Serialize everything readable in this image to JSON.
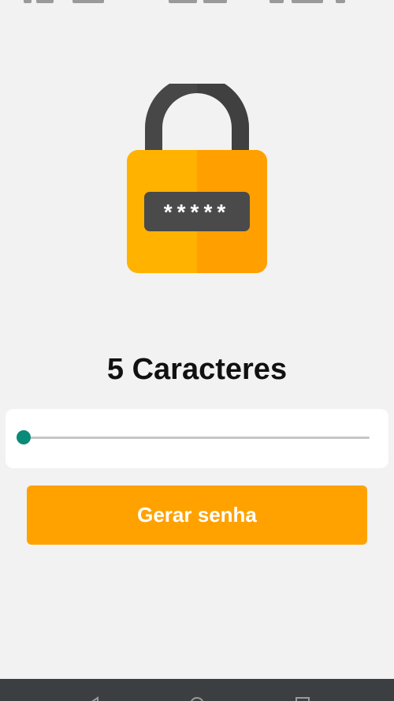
{
  "header": {
    "icon": "padlock-icon",
    "masked_password": "*****"
  },
  "length_label": "5 Caracteres",
  "slider": {
    "value": 5,
    "min": 5,
    "accent_color": "#0a8a78",
    "track_color": "#c6c6c6"
  },
  "button": {
    "label": "Gerar senha",
    "color": "#ffa200"
  },
  "navigation": {
    "items": [
      "back-icon",
      "home-icon",
      "recents-icon"
    ],
    "color": "#3c3f41"
  },
  "colors": {
    "background": "#f2f2f2",
    "lock_body": "#ffb300",
    "lock_body_shade": "#ffa000",
    "lock_shackle": "#474747"
  }
}
